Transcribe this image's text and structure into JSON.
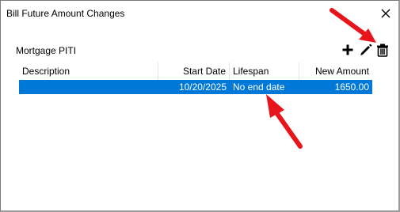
{
  "dialog": {
    "title": "Bill Future Amount Changes",
    "close_glyph": "✕"
  },
  "section": {
    "label": "Mortgage PITI"
  },
  "toolbar": {
    "add_icon": "plus-icon",
    "edit_icon": "pencil-icon",
    "delete_icon": "trash-icon"
  },
  "table": {
    "columns": [
      "Description",
      "Start Date",
      "Lifespan",
      "New Amount"
    ],
    "rows": [
      {
        "description": "",
        "start_date": "10/20/2025",
        "lifespan": "No end date",
        "new_amount": "1650.00",
        "selected": true
      }
    ]
  },
  "colors": {
    "selection": "#0078d7",
    "annotation_arrow": "#e8141c"
  }
}
